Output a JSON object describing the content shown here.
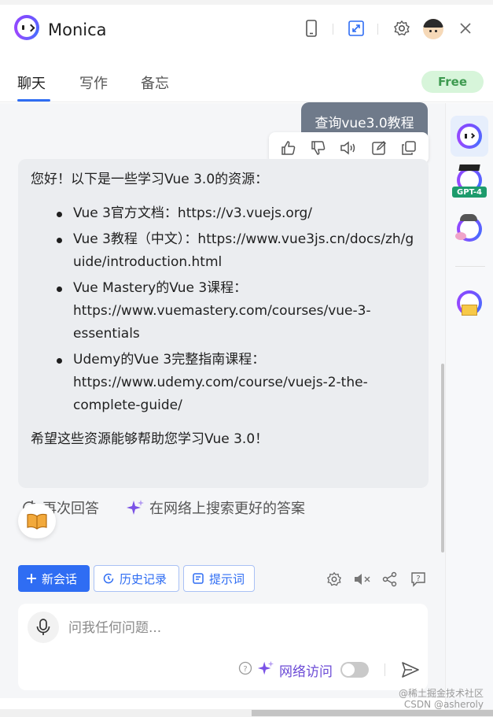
{
  "header": {
    "app_title": "Monica"
  },
  "tabs": [
    {
      "label": "聊天",
      "active": true
    },
    {
      "label": "写作",
      "active": false
    },
    {
      "label": "备忘",
      "active": false
    }
  ],
  "badge": {
    "plan": "Free"
  },
  "chat": {
    "user_message": "查询vue3.0教程",
    "answer": {
      "intro": "您好！以下是一些学习Vue 3.0的资源：",
      "items": [
        "Vue 3官方文档：https://v3.vuejs.org/",
        "Vue 3教程（中文）：https://www.vue3js.cn/docs/zh/guide/introduction.html",
        "Vue Mastery的Vue 3课程：https://www.vuemastery.com/courses/vue-3-essentials",
        "Udemy的Vue 3完整指南课程：https://www.udemy.com/course/vuejs-2-the-complete-guide/"
      ],
      "outro": "希望这些资源能够帮助您学习Vue 3.0！"
    },
    "retry_label": "再次回答",
    "search_better_label": "在网络上搜索更好的答案"
  },
  "rail": {
    "gpt4_tag": "GPT-4"
  },
  "toolbar": {
    "new_chat": "新会话",
    "history": "历史记录",
    "prompts": "提示词"
  },
  "input": {
    "placeholder": "问我任何问题...",
    "web_access_label": "网络访问",
    "web_access_enabled": false
  },
  "watermark": {
    "line1": "@稀土掘金技术社区",
    "line2": "CSDN @asheroly"
  },
  "colors": {
    "accent": "#2f6df3",
    "user_bubble": "#6f7a8a",
    "free_badge_bg": "#d7f5da",
    "free_badge_text": "#3e9a50",
    "web_access": "#6b4ad6"
  }
}
